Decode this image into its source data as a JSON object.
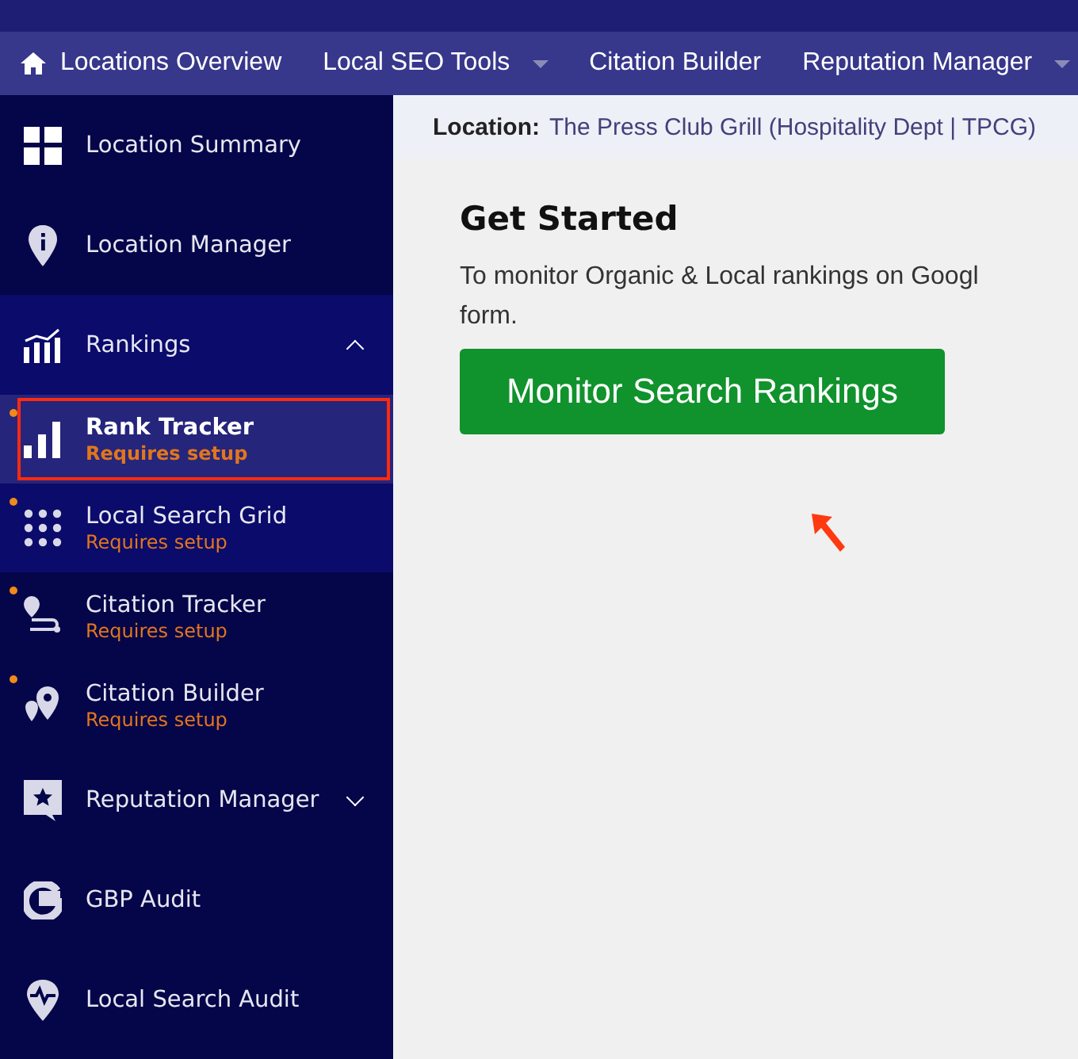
{
  "nav": [
    {
      "label": "Locations Overview",
      "dropdown": false
    },
    {
      "label": "Local SEO Tools",
      "dropdown": true
    },
    {
      "label": "Citation Builder",
      "dropdown": false
    },
    {
      "label": "Reputation Manager",
      "dropdown": true
    }
  ],
  "sidebar": {
    "items": [
      {
        "label": "Location Summary",
        "highlighted": false
      },
      {
        "label": "Location Manager",
        "highlighted": false
      },
      {
        "label": "Rankings",
        "highlighted": true,
        "expanded": true,
        "children": [
          {
            "label": "Rank Tracker",
            "sublabel": "Requires setup",
            "selected": true,
            "highlighted": true,
            "dot": true,
            "outlined": true
          },
          {
            "label": "Local Search Grid",
            "sublabel": "Requires setup",
            "selected": false,
            "highlighted": true,
            "dot": true,
            "outlined": false
          },
          {
            "label": "Citation Tracker",
            "sublabel": "Requires setup",
            "selected": false,
            "highlighted": false,
            "dot": true,
            "outlined": false
          },
          {
            "label": "Citation Builder",
            "sublabel": "Requires setup",
            "selected": false,
            "highlighted": false,
            "dot": true,
            "outlined": false
          }
        ]
      },
      {
        "label": "Reputation Manager",
        "highlighted": false,
        "expanded": false
      },
      {
        "label": "GBP Audit",
        "highlighted": false
      },
      {
        "label": "Local Search Audit",
        "highlighted": false
      }
    ]
  },
  "location_bar": {
    "label": "Location:",
    "value": "The Press Club Grill (Hospitality Dept | TPCG)"
  },
  "content": {
    "title": "Get Started",
    "lines": [
      "To monitor Organic & Local rankings on Googl",
      "form."
    ],
    "button": "Monitor Search Rankings",
    "pointer_arrow": true
  }
}
